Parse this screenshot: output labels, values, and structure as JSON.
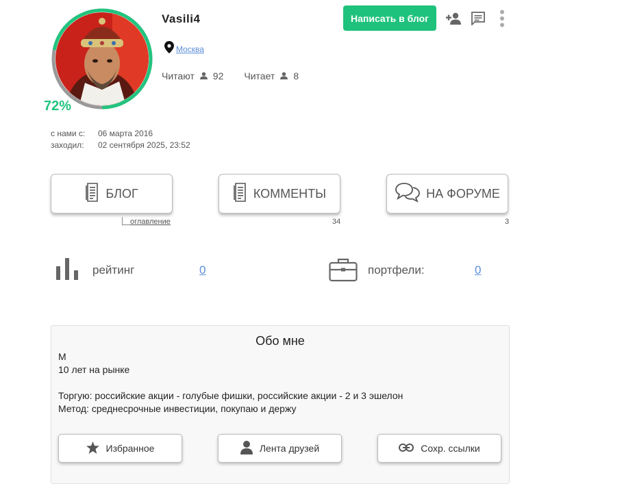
{
  "profile": {
    "username": "Vasili4",
    "progress_percent": 72,
    "progress_label": "72%",
    "location": "Москва",
    "followers_label": "Читают",
    "followers_count": "92",
    "following_label": "Читает",
    "following_count": "8"
  },
  "header": {
    "write_button": "Написать в блог",
    "icons": [
      "add-person-icon",
      "message-icon",
      "more-vertical-icon"
    ]
  },
  "dates": {
    "joined_label": "с нами с:",
    "joined_value": "06 марта 2016",
    "visited_label": "заходил:",
    "visited_value": "02 сентября 2025, 23:52"
  },
  "tabs": [
    {
      "label": "БЛОГ",
      "sub": "оглавление",
      "icon": "document-icon"
    },
    {
      "label": "КОММЕНТЫ",
      "sub": "34",
      "icon": "document-icon"
    },
    {
      "label": "НА ФОРУМЕ",
      "sub": "3",
      "icon": "chat-bubbles-icon"
    }
  ],
  "stats": {
    "rating_label": "рейтинг",
    "rating_value": "0",
    "portfolio_label": "портфели:",
    "portfolio_value": "0"
  },
  "about": {
    "title": "Обо мне",
    "lines": [
      "М",
      "10 лет на рынке",
      "",
      "Торгую: российские акции - голубые фишки, российские акции - 2 и 3 эшелон",
      "Метод: среднесрочные инвестиции, покупаю и держу"
    ],
    "buttons": [
      "Избранное",
      "Лента друзей",
      "Сохр. ссылки"
    ]
  },
  "colors": {
    "accent_green": "#1fc27c",
    "link_blue": "#5b8dd9"
  }
}
